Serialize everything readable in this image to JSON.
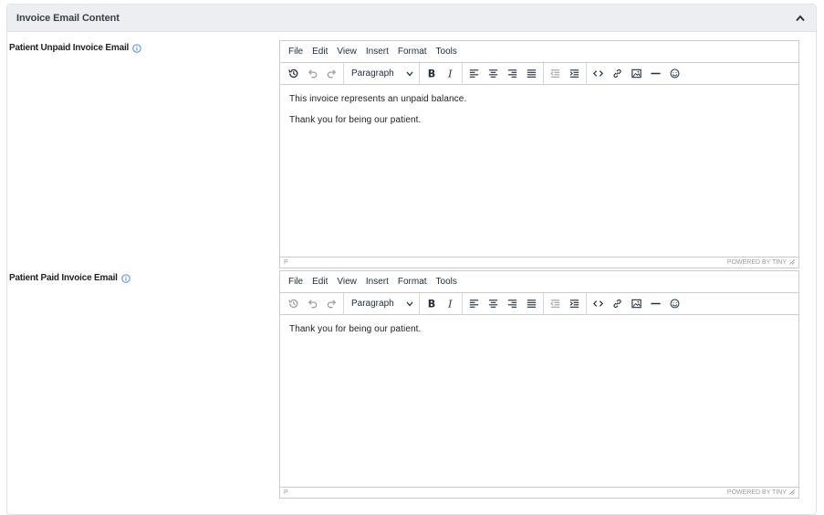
{
  "panel": {
    "title": "Invoice Email Content"
  },
  "editors": [
    {
      "label": "Patient Unpaid Invoice Email",
      "menu": [
        "File",
        "Edit",
        "View",
        "Insert",
        "Format",
        "Tools"
      ],
      "block_format": "Paragraph",
      "content": [
        "This invoice represents an unpaid balance.",
        "Thank you for being our patient."
      ],
      "path": "P",
      "branding": "POWERED BY TINY"
    },
    {
      "label": "Patient Paid Invoice Email",
      "menu": [
        "File",
        "Edit",
        "View",
        "Insert",
        "Format",
        "Tools"
      ],
      "block_format": "Paragraph",
      "content": [
        "Thank you for being our patient."
      ],
      "path": "P",
      "branding": "POWERED BY TINY"
    }
  ],
  "colors": {
    "header_bg": "#eceef1",
    "border": "#cccccc",
    "info_icon": "#4a7fc1"
  }
}
